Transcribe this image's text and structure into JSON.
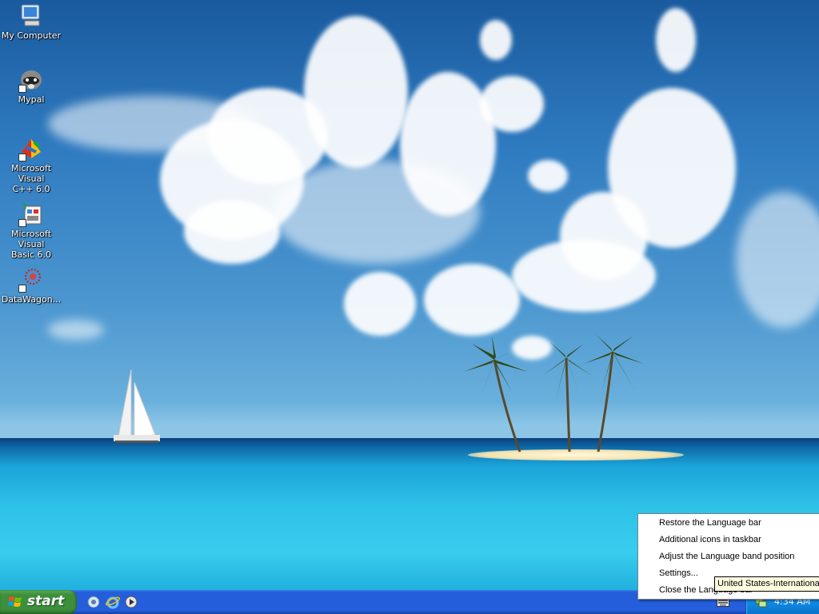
{
  "desktop": {
    "icons": [
      {
        "label_line1": "My Computer",
        "label_line2": "",
        "icon": "computer-icon"
      },
      {
        "label_line1": "Mypal",
        "label_line2": "",
        "icon": "raccoon-icon"
      },
      {
        "label_line1": "Microsoft Visual",
        "label_line2": "C++ 6.0",
        "icon": "visual-cpp-icon"
      },
      {
        "label_line1": "Microsoft Visual",
        "label_line2": "Basic 6.0",
        "icon": "visual-basic-icon"
      },
      {
        "label_line1": "DataWagon...",
        "label_line2": "",
        "icon": "datawagon-icon"
      }
    ]
  },
  "taskbar": {
    "start_label": "start",
    "quick_launch": [
      "settings-icon",
      "internet-explorer-icon",
      "media-player-icon"
    ],
    "clock": "4:34 AM"
  },
  "context_menu": {
    "items": [
      {
        "label": "Restore the Language bar"
      },
      {
        "label": "Additional icons in taskbar"
      },
      {
        "label": "Adjust the Language band position"
      },
      {
        "label": "Settings..."
      },
      {
        "label": "Close the Language bar"
      }
    ]
  },
  "tooltip": "United States-International",
  "colors": {
    "taskbar": "#245edb",
    "start": "#3c8f3b",
    "tray": "#0f8be6"
  }
}
